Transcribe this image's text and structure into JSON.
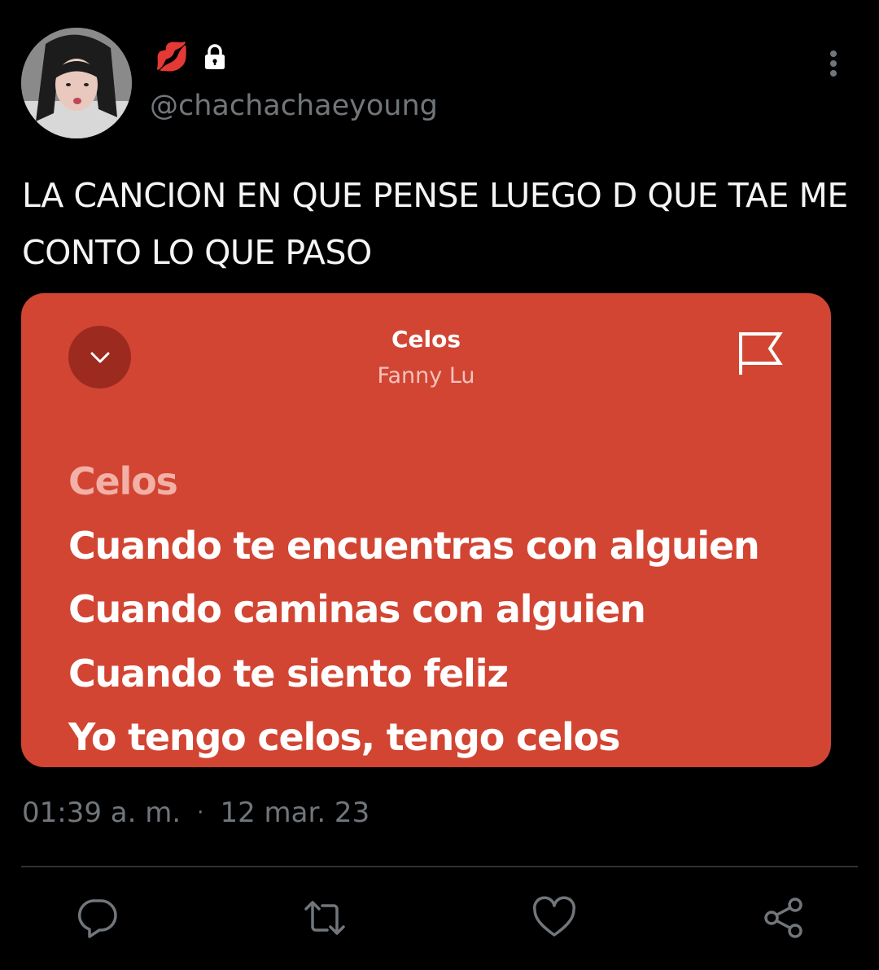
{
  "author": {
    "emoji": "💋",
    "handle": "@chachachaeyoung",
    "icons": [
      "lock-icon",
      "more-icon"
    ]
  },
  "tweet": {
    "text": "LA CANCION EN QUE PENSE LUEGO D QUE TAE ME\nCONTO LO QUE PASO"
  },
  "lyrics_card": {
    "song_title": "Celos",
    "artist": "Fanny Lu",
    "background_color": "#d24533",
    "lines": [
      "Celos",
      "Cuando te encuentras con alguien",
      "Cuando caminas con alguien",
      "Cuando te siento feliz",
      "Yo tengo celos, tengo celos"
    ],
    "icons": [
      "chevron-down-icon",
      "flag-icon"
    ]
  },
  "meta": {
    "time": "01:39 a. m.",
    "separator": "·",
    "date": "12 mar. 23"
  },
  "actions": [
    "reply-icon",
    "retweet-icon",
    "like-icon",
    "share-icon"
  ],
  "colors": {
    "background": "#000000",
    "secondary_text": "#71767b",
    "divider": "#2f3336"
  }
}
